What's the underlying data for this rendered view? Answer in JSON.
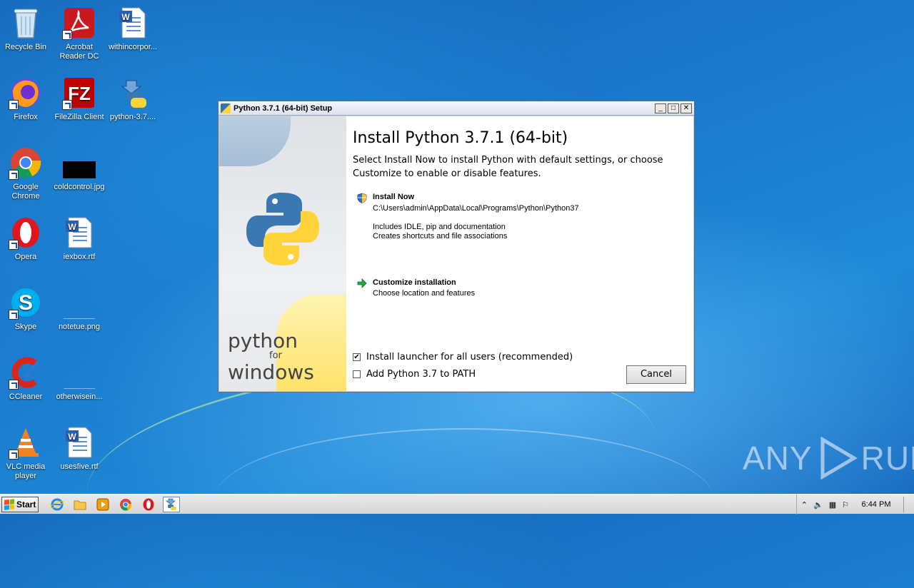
{
  "desktop": {
    "icons": [
      {
        "label": "Recycle Bin"
      },
      {
        "label": "Acrobat Reader DC"
      },
      {
        "label": "withincorpor..."
      },
      {
        "label": "Firefox"
      },
      {
        "label": "FileZilla Client"
      },
      {
        "label": "python-3.7...."
      },
      {
        "label": "Google Chrome"
      },
      {
        "label": "coldcontrol.jpg"
      },
      {
        "label": "Opera"
      },
      {
        "label": "iexbox.rtf"
      },
      {
        "label": "Skype"
      },
      {
        "label": "notetue.png"
      },
      {
        "label": "CCleaner"
      },
      {
        "label": "otherwisein..."
      },
      {
        "label": "VLC media player"
      },
      {
        "label": "usesfive.rtf"
      }
    ]
  },
  "setup_window": {
    "title": "Python 3.7.1 (64-bit) Setup",
    "heading": "Install Python 3.7.1 (64-bit)",
    "intro": "Select Install Now to install Python with default settings, or choose Customize to enable or disable features.",
    "install_now": {
      "title": "Install Now",
      "path": "C:\\Users\\admin\\AppData\\Local\\Programs\\Python\\Python37",
      "line1": "Includes IDLE, pip and documentation",
      "line2": "Creates shortcuts and file associations"
    },
    "customize": {
      "title": "Customize installation",
      "subtitle": "Choose location and features"
    },
    "launcher_checkbox": {
      "label": "Install launcher for all users (recommended)",
      "checked": true
    },
    "path_checkbox": {
      "label": "Add Python 3.7 to PATH",
      "checked": false
    },
    "cancel_label": "Cancel",
    "logo_word_top": "python",
    "logo_word_mid": "for",
    "logo_word_bottom": "windows"
  },
  "watermark": {
    "left": "ANY",
    "right": "RUN"
  },
  "taskbar": {
    "start_label": "Start",
    "clock": "6:44 PM"
  }
}
